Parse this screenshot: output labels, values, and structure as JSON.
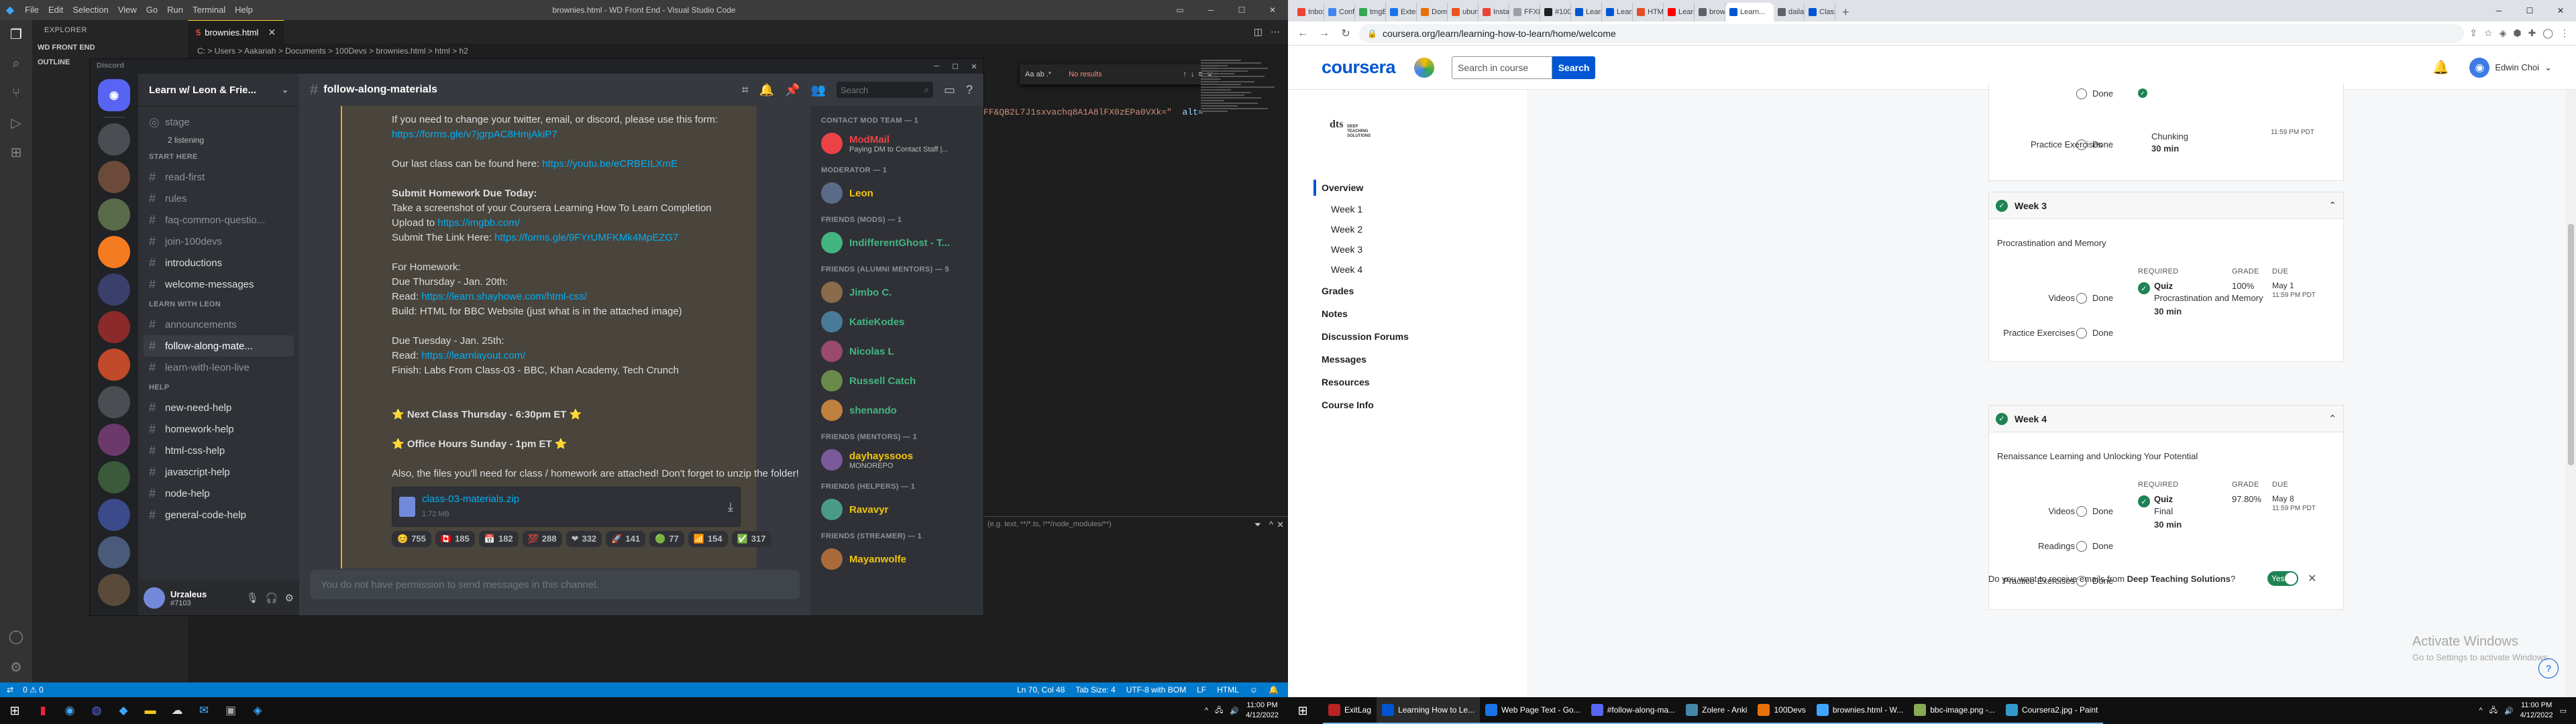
{
  "vscode": {
    "window_title": "brownies.html - WD Front End - Visual Studio Code",
    "menu": [
      "File",
      "Edit",
      "Selection",
      "View",
      "Go",
      "Run",
      "Terminal",
      "Help"
    ],
    "explorer_title": "EXPLORER",
    "sections": [
      "WD FRONT END",
      "OUTLINE"
    ],
    "tab_label": "brownies.html",
    "breadcrumb": "C: > Users > Aakariah > Documents > 100Devs > brownies.html > html > h2",
    "find_text": "Aa  ab  .*",
    "find_result": "No results",
    "code_line_1": "FF&QB2L7J1sxvachq8A1A8lFX0zEPa0VXk=\"",
    "code_line_2": "alt=",
    "panel_filter": "(e.g. text, **/*.ts, !**/node_modules/**)",
    "status_left": [
      "0 ⚠ 0"
    ],
    "status_right": [
      "Ln 70, Col 48",
      "Tab Size: 4",
      "UTF-8 with BOM",
      "LF",
      "HTML"
    ]
  },
  "discord": {
    "brand": "Discord",
    "server_name": "Learn w/ Leon & Frie...",
    "channel_title": "follow-along-materials",
    "search_placeholder": "Search",
    "stage": {
      "name": "stage",
      "listening": "2 listening"
    },
    "categories": [
      "START HERE",
      "LEARN WITH LEON",
      "HELP"
    ],
    "channels_start": [
      "read-first",
      "rules",
      "faq-common-questio...",
      "join-100devs",
      "introductions",
      "welcome-messages"
    ],
    "channels_leon": [
      "announcements",
      "follow-along-mate...",
      "learn-with-leon-live"
    ],
    "channels_help": [
      "new-need-help",
      "homework-help",
      "html-css-help",
      "javascript-help",
      "node-help",
      "general-code-help"
    ],
    "user": {
      "name": "Urzaleus",
      "tag": "#7103"
    },
    "messages": [
      {
        "text": "If you need to change your twitter, email, or discord, please use this form:"
      },
      {
        "link": "https://forms.gle/v7jgrpAC8HmjAkiP7"
      },
      {
        "gap": true
      },
      {
        "text": "Our last class can be found here: ",
        "link": "https://youtu.be/eCRBEILXmE"
      },
      {
        "gap": true
      },
      {
        "bold": "Submit Homework Due Today:"
      },
      {
        "text": "Take a screenshot of your Coursera Learning How To Learn Completion"
      },
      {
        "text": "Upload to ",
        "link": "https://imgbb.com/"
      },
      {
        "text": "Submit The Link Here: ",
        "link": "https://forms.gle/9FYrUMFKMk4MpEZG7"
      },
      {
        "gap": true
      },
      {
        "text": "For Homework:"
      },
      {
        "text": "Due Thursday - Jan. 20th:"
      },
      {
        "text": "Read: ",
        "link": "https://learn.shayhowe.com/html-css/"
      },
      {
        "text": "Build: HTML for BBC Website (just what is in the attached image)"
      },
      {
        "gap": true
      },
      {
        "text": "Due Tuesday - Jan. 25th:"
      },
      {
        "text": "Read: ",
        "link": "https://learnlayout.com/"
      },
      {
        "text": "Finish: Labs From Class-03 - BBC, Khan Academy, Tech Crunch"
      },
      {
        "gap": true
      },
      {
        "gap": true
      },
      {
        "bold": "⭐ Next Class Thursday - 6:30pm ET ⭐"
      },
      {
        "gap": true
      },
      {
        "bold": "⭐ Office Hours Sunday - 1pm ET ⭐"
      },
      {
        "gap": true
      },
      {
        "text": "Also, the files you'll need for class / homework are attached! Don't forget to unzip the folder!"
      }
    ],
    "attachment": {
      "name": "class-03-materials.zip",
      "size": "1.72 MB"
    },
    "reactions": [
      "755",
      "185",
      "182",
      "288",
      "332",
      "141",
      "77",
      "154",
      "317"
    ],
    "input_placeholder": "You do not have permission to send messages in this channel.",
    "member_sections": [
      {
        "title": "CONTACT MOD TEAM — 1",
        "members": [
          {
            "name": "ModMail",
            "status": "Paying DM to Contact Staff |...",
            "color": "#ed4245"
          }
        ]
      },
      {
        "title": "MODERATOR — 1",
        "members": [
          {
            "name": "Leon",
            "status": "",
            "color": "#f1c40f"
          }
        ]
      },
      {
        "title": "FRIENDS (MODS) — 1",
        "members": [
          {
            "name": "IndifferentGhost - T...",
            "status": "",
            "color": "#43b581"
          }
        ]
      },
      {
        "title": "FRIENDS (ALUMNI MENTORS) — 5",
        "members": [
          {
            "name": "Jimbo C.",
            "status": "",
            "color": "#43b581"
          },
          {
            "name": "KatieKodes",
            "status": "",
            "color": "#43b581"
          },
          {
            "name": "Nicolas L",
            "status": "",
            "color": "#43b581"
          },
          {
            "name": "Russell Catch",
            "status": "",
            "color": "#43b581"
          },
          {
            "name": "shenando",
            "status": "",
            "color": "#43b581"
          }
        ]
      },
      {
        "title": "FRIENDS (MENTORS) — 1",
        "members": [
          {
            "name": "dayhayssoos",
            "status": "MONOREPO",
            "color": "#f1c40f"
          }
        ]
      },
      {
        "title": "FRIENDS (HELPERS) — 1",
        "members": [
          {
            "name": "Ravavyr",
            "status": "",
            "color": "#f1c40f"
          }
        ]
      },
      {
        "title": "FRIENDS (STREAMER) — 1",
        "members": [
          {
            "name": "Mayanwolfe",
            "status": "",
            "color": "#f1c40f"
          }
        ]
      }
    ]
  },
  "chrome": {
    "tabs": [
      "Inbox",
      "Conf...",
      "tmgE...",
      "Exten...",
      "Dom...",
      "ubun...",
      "Instal...",
      "FFXIV...",
      "#100...",
      "Learn...",
      "Learn...",
      "HTML...",
      "Learn...",
      "brow...",
      "Learn...",
      "daila...",
      "Class"
    ],
    "active_tab": "Learn...",
    "url": "coursera.org/learn/learning-how-to-learn/home/welcome"
  },
  "coursera": {
    "logo": "coursera",
    "search_placeholder": "Search in course",
    "search_button": "Search",
    "user_name": "Edwin Choi",
    "partner": [
      "DEEP",
      "TEACHING",
      "SOLUTIONS"
    ],
    "nav": [
      "Overview",
      "Week 1",
      "Week 2",
      "Week 3",
      "Week 4",
      "Grades",
      "Notes",
      "Discussion Forums",
      "Messages",
      "Resources",
      "Course Info"
    ],
    "top_card": {
      "done1": "Done",
      "topic": "Chunking",
      "time": "30 min",
      "practice": "Practice Exercises",
      "done2": "Done",
      "due_time": "11:59 PM PDT"
    },
    "weeks": [
      {
        "title": "Week 3",
        "topic": "Procrastination and Memory",
        "rows": [
          "Videos",
          "Practice Exercises"
        ],
        "required": "REQUIRED",
        "grade_h": "GRADE",
        "due_h": "DUE",
        "quiz": "Quiz",
        "quiz_name": "Procrastination and Memory",
        "quiz_time": "30 min",
        "grade": "100%",
        "due": "May 1",
        "due_time": "11:59 PM PDT"
      },
      {
        "title": "Week 4",
        "topic": "Renaissance Learning and Unlocking Your Potential",
        "rows": [
          "Videos",
          "Readings",
          "Practice Exercises"
        ],
        "required": "REQUIRED",
        "grade_h": "GRADE",
        "due_h": "DUE",
        "quiz": "Quiz",
        "quiz_name": "Final",
        "quiz_time": "30 min",
        "grade": "97.80%",
        "due": "May 8",
        "due_time": "11:59 PM PDT"
      }
    ],
    "done_label": "Done",
    "email_prompt": "Do you want to receive emails from ",
    "email_brand": "Deep Teaching Solutions",
    "email_suffix": "?",
    "toggle": "Yes",
    "activate": {
      "title": "Activate Windows",
      "sub": "Go to Settings to activate Windows."
    }
  },
  "taskbar_left": {
    "time": "11:00 PM",
    "date": "4/12/2022"
  },
  "taskbar_right": {
    "apps": [
      "ExitLag",
      "Learning How to Le...",
      "Web Page Text - Go...",
      "#follow-along-ma...",
      "Zolere - Anki",
      "100Devs",
      "brownies.html - W...",
      "bbc-image.png -...",
      "Coursera2.jpg - Paint"
    ],
    "time": "11:00 PM",
    "date": "4/12/2022"
  }
}
